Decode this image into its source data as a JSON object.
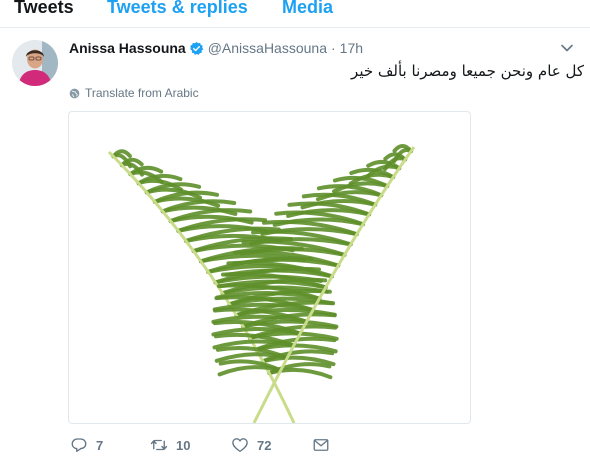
{
  "tabs": [
    {
      "label": "Tweets"
    },
    {
      "label": "Tweets & replies"
    },
    {
      "label": "Media"
    }
  ],
  "tweet": {
    "author_name": "Anissa Hassouna",
    "handle": "@AnissaHassouna",
    "separator": "·",
    "time": "17h",
    "text": "كل عام ونحن جميعا ومصرنا بألف خير",
    "translate_label": "Translate from Arabic",
    "stats": {
      "replies": "7",
      "retweets": "10",
      "likes": "72"
    }
  },
  "colors": {
    "accent": "#1da1f2",
    "muted": "#657786",
    "text": "#14171a",
    "palm_leaf": "#5e8f2a",
    "palm_stem": "#c9dc8a"
  },
  "icons": {
    "verified": "verified-badge-icon",
    "caret": "chevron-down-icon",
    "translate": "globe-icon",
    "reply": "reply-icon",
    "retweet": "retweet-icon",
    "like": "heart-icon",
    "message": "envelope-icon"
  }
}
